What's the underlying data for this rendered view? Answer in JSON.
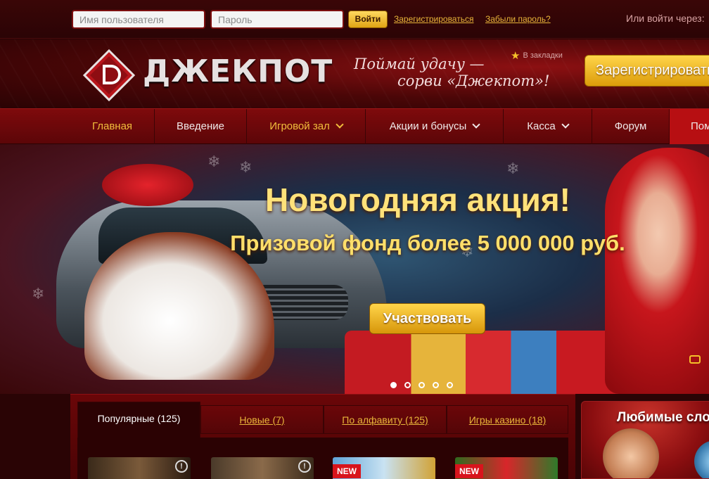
{
  "topbar": {
    "username_placeholder": "Имя пользователя",
    "password_placeholder": "Пароль",
    "login_label": "Войти",
    "register_link": "Зарегистрироваться",
    "forgot_link": "Забыли пароль?",
    "or_login_with": "Или войти через:"
  },
  "header": {
    "logo_text": "ДЖЕКПОТ",
    "slogan_line1": "Поймай удачу —",
    "slogan_line2": "сорви «Джекпот»!",
    "bookmark_label": "В закладки",
    "register_button": "Зарегистрироваться"
  },
  "nav": {
    "items": [
      {
        "label": "Главная",
        "dropdown": false
      },
      {
        "label": "Введение",
        "dropdown": false
      },
      {
        "label": "Игровой зал",
        "dropdown": true
      },
      {
        "label": "Акции и бонусы",
        "dropdown": true
      },
      {
        "label": "Касса",
        "dropdown": true
      },
      {
        "label": "Форум",
        "dropdown": false
      },
      {
        "label": "Помощь",
        "dropdown": false
      }
    ]
  },
  "banner": {
    "title": "Новогодняя акция!",
    "subtitle": "Призовой фонд более 5 000 000 руб.",
    "cta": "Участвовать",
    "slides_total": 5,
    "slide_active": 1
  },
  "games": {
    "tabs": [
      {
        "label": "Популярные (125)",
        "active": true
      },
      {
        "label": "Новые (7)",
        "active": false
      },
      {
        "label": "По алфавиту (125)",
        "active": false
      },
      {
        "label": "Игры казино (18)",
        "active": false
      }
    ],
    "thumbs": [
      {
        "badge": "",
        "info": "!"
      },
      {
        "badge": "",
        "info": "!"
      },
      {
        "badge": "NEW",
        "info": ""
      },
      {
        "badge": "NEW",
        "info": ""
      }
    ]
  },
  "favorites": {
    "title": "Любимые слоты"
  },
  "colors": {
    "background": "#2a0405",
    "accent_gold": "#f1bd3c",
    "nav_red": "#7e0a0c",
    "help_tab": "#b70f12"
  }
}
